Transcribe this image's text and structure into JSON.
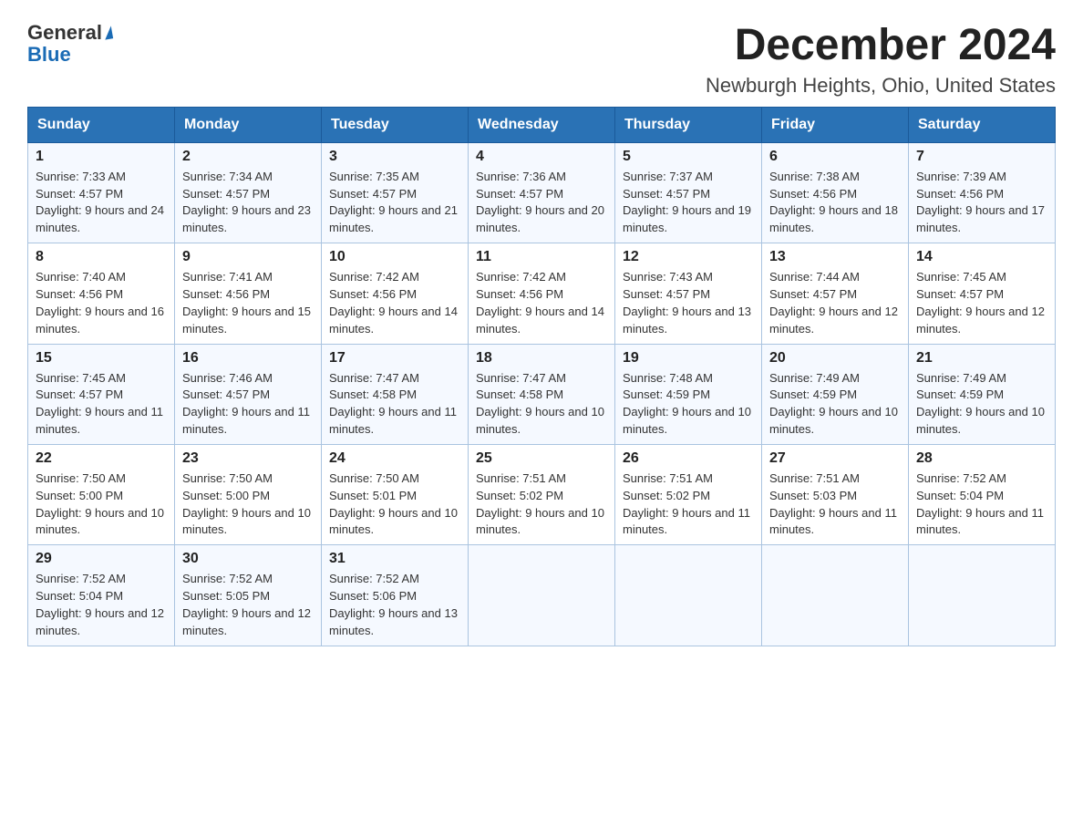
{
  "header": {
    "logo_general": "General",
    "logo_blue": "Blue",
    "title": "December 2024",
    "subtitle": "Newburgh Heights, Ohio, United States"
  },
  "calendar": {
    "weekdays": [
      "Sunday",
      "Monday",
      "Tuesday",
      "Wednesday",
      "Thursday",
      "Friday",
      "Saturday"
    ],
    "weeks": [
      [
        {
          "day": "1",
          "sunrise": "7:33 AM",
          "sunset": "4:57 PM",
          "daylight": "9 hours and 24 minutes."
        },
        {
          "day": "2",
          "sunrise": "7:34 AM",
          "sunset": "4:57 PM",
          "daylight": "9 hours and 23 minutes."
        },
        {
          "day": "3",
          "sunrise": "7:35 AM",
          "sunset": "4:57 PM",
          "daylight": "9 hours and 21 minutes."
        },
        {
          "day": "4",
          "sunrise": "7:36 AM",
          "sunset": "4:57 PM",
          "daylight": "9 hours and 20 minutes."
        },
        {
          "day": "5",
          "sunrise": "7:37 AM",
          "sunset": "4:57 PM",
          "daylight": "9 hours and 19 minutes."
        },
        {
          "day": "6",
          "sunrise": "7:38 AM",
          "sunset": "4:56 PM",
          "daylight": "9 hours and 18 minutes."
        },
        {
          "day": "7",
          "sunrise": "7:39 AM",
          "sunset": "4:56 PM",
          "daylight": "9 hours and 17 minutes."
        }
      ],
      [
        {
          "day": "8",
          "sunrise": "7:40 AM",
          "sunset": "4:56 PM",
          "daylight": "9 hours and 16 minutes."
        },
        {
          "day": "9",
          "sunrise": "7:41 AM",
          "sunset": "4:56 PM",
          "daylight": "9 hours and 15 minutes."
        },
        {
          "day": "10",
          "sunrise": "7:42 AM",
          "sunset": "4:56 PM",
          "daylight": "9 hours and 14 minutes."
        },
        {
          "day": "11",
          "sunrise": "7:42 AM",
          "sunset": "4:56 PM",
          "daylight": "9 hours and 14 minutes."
        },
        {
          "day": "12",
          "sunrise": "7:43 AM",
          "sunset": "4:57 PM",
          "daylight": "9 hours and 13 minutes."
        },
        {
          "day": "13",
          "sunrise": "7:44 AM",
          "sunset": "4:57 PM",
          "daylight": "9 hours and 12 minutes."
        },
        {
          "day": "14",
          "sunrise": "7:45 AM",
          "sunset": "4:57 PM",
          "daylight": "9 hours and 12 minutes."
        }
      ],
      [
        {
          "day": "15",
          "sunrise": "7:45 AM",
          "sunset": "4:57 PM",
          "daylight": "9 hours and 11 minutes."
        },
        {
          "day": "16",
          "sunrise": "7:46 AM",
          "sunset": "4:57 PM",
          "daylight": "9 hours and 11 minutes."
        },
        {
          "day": "17",
          "sunrise": "7:47 AM",
          "sunset": "4:58 PM",
          "daylight": "9 hours and 11 minutes."
        },
        {
          "day": "18",
          "sunrise": "7:47 AM",
          "sunset": "4:58 PM",
          "daylight": "9 hours and 10 minutes."
        },
        {
          "day": "19",
          "sunrise": "7:48 AM",
          "sunset": "4:59 PM",
          "daylight": "9 hours and 10 minutes."
        },
        {
          "day": "20",
          "sunrise": "7:49 AM",
          "sunset": "4:59 PM",
          "daylight": "9 hours and 10 minutes."
        },
        {
          "day": "21",
          "sunrise": "7:49 AM",
          "sunset": "4:59 PM",
          "daylight": "9 hours and 10 minutes."
        }
      ],
      [
        {
          "day": "22",
          "sunrise": "7:50 AM",
          "sunset": "5:00 PM",
          "daylight": "9 hours and 10 minutes."
        },
        {
          "day": "23",
          "sunrise": "7:50 AM",
          "sunset": "5:00 PM",
          "daylight": "9 hours and 10 minutes."
        },
        {
          "day": "24",
          "sunrise": "7:50 AM",
          "sunset": "5:01 PM",
          "daylight": "9 hours and 10 minutes."
        },
        {
          "day": "25",
          "sunrise": "7:51 AM",
          "sunset": "5:02 PM",
          "daylight": "9 hours and 10 minutes."
        },
        {
          "day": "26",
          "sunrise": "7:51 AM",
          "sunset": "5:02 PM",
          "daylight": "9 hours and 11 minutes."
        },
        {
          "day": "27",
          "sunrise": "7:51 AM",
          "sunset": "5:03 PM",
          "daylight": "9 hours and 11 minutes."
        },
        {
          "day": "28",
          "sunrise": "7:52 AM",
          "sunset": "5:04 PM",
          "daylight": "9 hours and 11 minutes."
        }
      ],
      [
        {
          "day": "29",
          "sunrise": "7:52 AM",
          "sunset": "5:04 PM",
          "daylight": "9 hours and 12 minutes."
        },
        {
          "day": "30",
          "sunrise": "7:52 AM",
          "sunset": "5:05 PM",
          "daylight": "9 hours and 12 minutes."
        },
        {
          "day": "31",
          "sunrise": "7:52 AM",
          "sunset": "5:06 PM",
          "daylight": "9 hours and 13 minutes."
        },
        null,
        null,
        null,
        null
      ]
    ]
  }
}
